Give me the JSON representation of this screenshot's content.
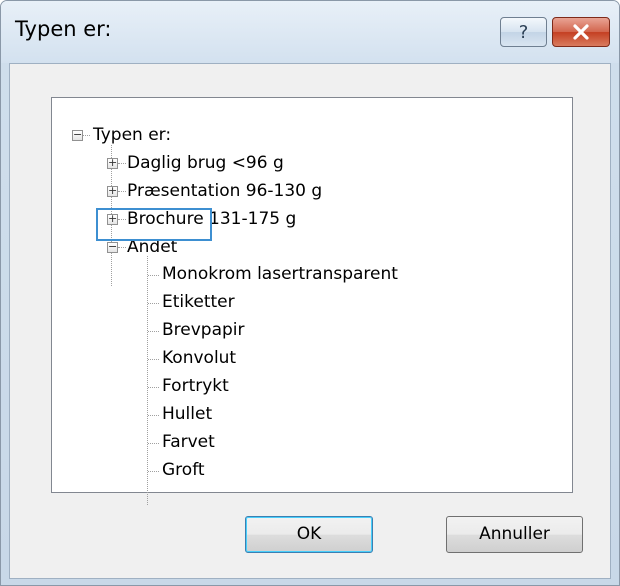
{
  "window": {
    "title": "Typen er:",
    "help_symbol": "?"
  },
  "tree": {
    "root": "Typen er:",
    "groups": [
      {
        "label": "Daglig brug <96 g",
        "state": "collapsed"
      },
      {
        "label": "Præsentation 96-130 g",
        "state": "collapsed"
      },
      {
        "label": "Brochure 131-175 g",
        "state": "collapsed"
      },
      {
        "label": "Andet",
        "state": "expanded"
      }
    ],
    "andet_children": [
      "Monokrom lasertransparent",
      "Etiketter",
      "Brevpapir",
      "Konvolut",
      "Fortrykt",
      "Hullet",
      "Farvet",
      "Groft"
    ],
    "selected": "Etiketter"
  },
  "buttons": {
    "ok": "OK",
    "cancel": "Annuller"
  },
  "colors": {
    "selection_outline": "#3d8fd1",
    "close_button": "#c43f22"
  }
}
